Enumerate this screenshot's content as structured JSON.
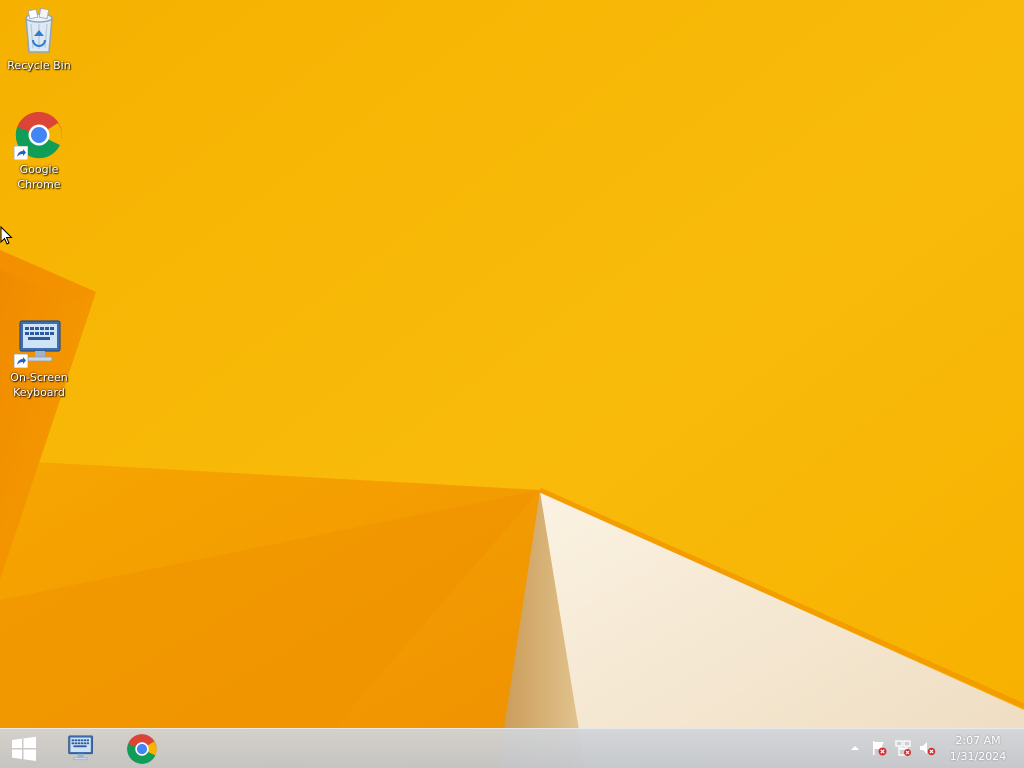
{
  "desktop": {
    "wallpaper_color": "#F8B605",
    "icons": [
      {
        "label": "Recycle Bin",
        "icon": "recycle-bin-icon"
      },
      {
        "label": "Google\nChrome",
        "icon": "chrome-icon"
      },
      {
        "label": "On-Screen\nKeyboard",
        "icon": "on-screen-keyboard-icon"
      }
    ]
  },
  "taskbar": {
    "start_icon": "windows-start-icon",
    "pinned": [
      {
        "icon": "on-screen-keyboard-icon"
      },
      {
        "icon": "chrome-icon"
      }
    ],
    "tray": {
      "icons": [
        "show-hidden-icons-arrow-icon",
        "action-center-flag-icon",
        "network-icon",
        "volume-muted-icon"
      ],
      "time": "2:07 AM",
      "date": "1/31/2024"
    }
  }
}
